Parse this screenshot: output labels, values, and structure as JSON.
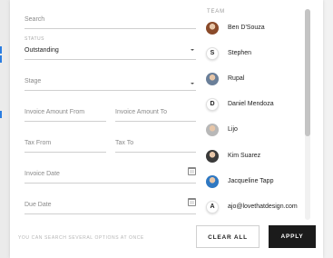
{
  "filters": {
    "search": {
      "placeholder": "Search"
    },
    "status": {
      "label": "STATUS",
      "value": "Outstanding"
    },
    "stage": {
      "placeholder": "Stage"
    },
    "invoice_amount_from": {
      "placeholder": "Invoice Amount From"
    },
    "invoice_amount_to": {
      "placeholder": "Invoice Amount To"
    },
    "tax_from": {
      "placeholder": "Tax From"
    },
    "tax_to": {
      "placeholder": "Tax To"
    },
    "invoice_date": {
      "placeholder": "Invoice Date"
    },
    "due_date": {
      "placeholder": "Due Date"
    },
    "hint": "YOU CAN SEARCH SEVERAL OPTIONS AT ONCE"
  },
  "team": {
    "label": "TEAM",
    "members": [
      {
        "name": "Ben D'Souza",
        "avatar": "photo",
        "color": "#8a4a2a"
      },
      {
        "name": "Stephen",
        "avatar": "letter",
        "letter": "S"
      },
      {
        "name": "Rupal",
        "avatar": "photo",
        "color": "#6a7f99"
      },
      {
        "name": "Daniel Mendoza",
        "avatar": "letter",
        "letter": "D"
      },
      {
        "name": "Lijo",
        "avatar": "photo",
        "color": "#b8b8b8"
      },
      {
        "name": "Kim Suarez",
        "avatar": "photo",
        "color": "#3a3a3a"
      },
      {
        "name": "Jacqueline Tapp",
        "avatar": "photo",
        "color": "#2f78c2"
      },
      {
        "name": "ajo@lovethatdesign.com",
        "avatar": "letter",
        "letter": "A"
      }
    ]
  },
  "actions": {
    "clear_label": "CLEAR ALL",
    "apply_label": "APPLY"
  }
}
